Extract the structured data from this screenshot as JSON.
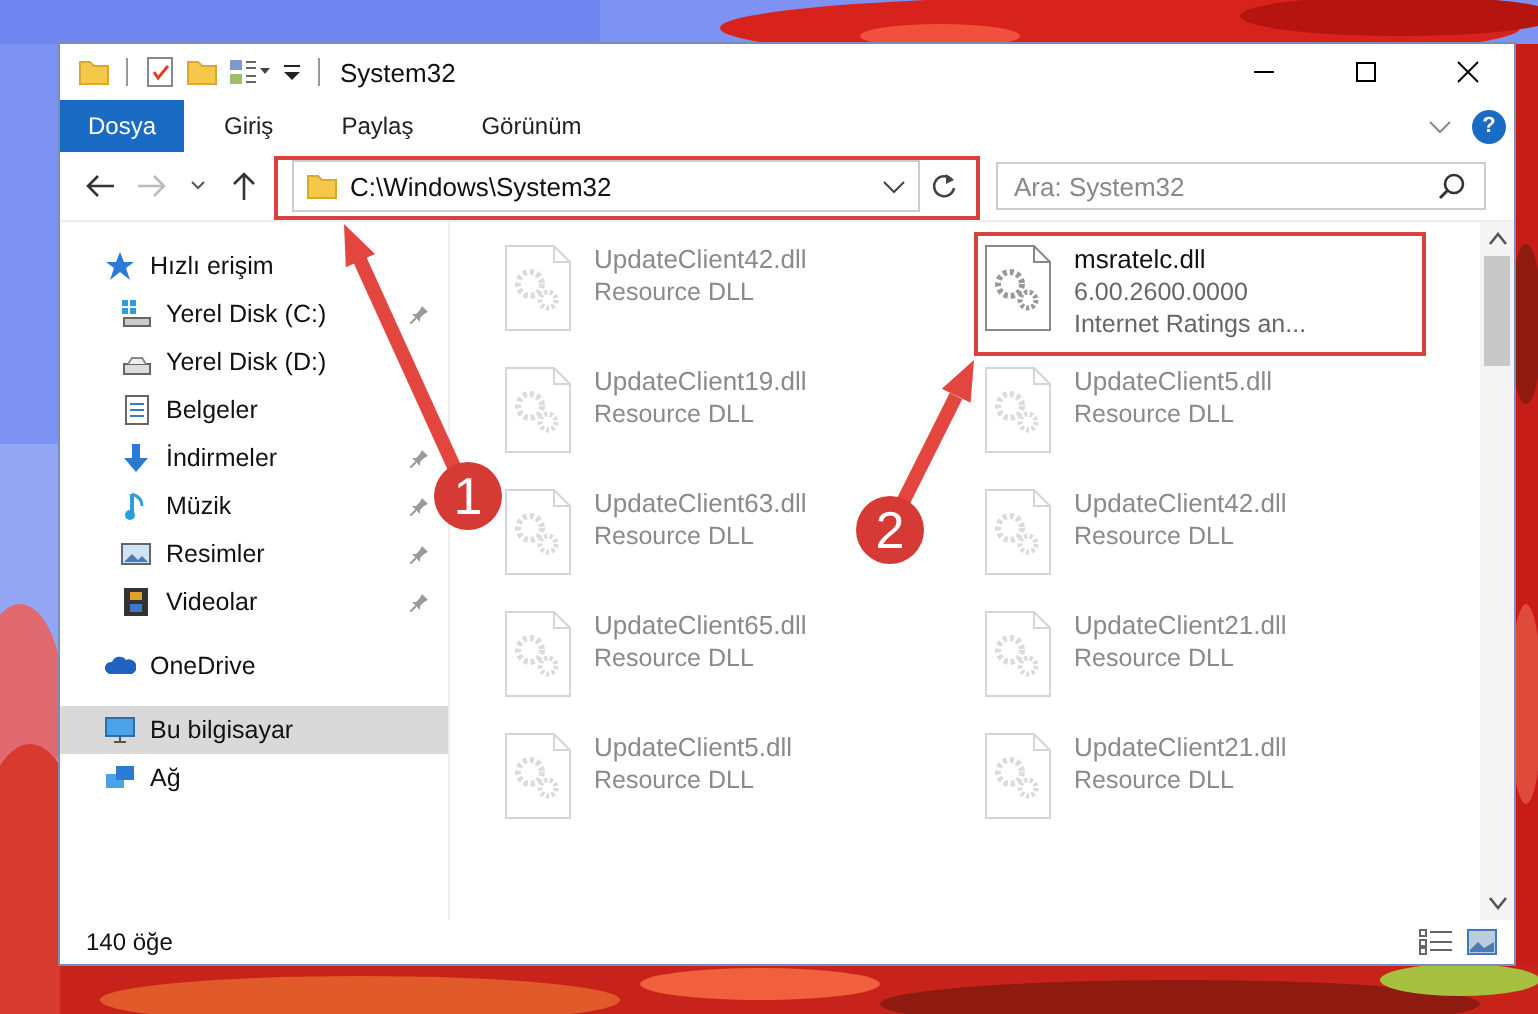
{
  "window": {
    "title": "System32"
  },
  "ribbon_tabs": [
    {
      "label": "Dosya",
      "selected": true
    },
    {
      "label": "Giriş",
      "selected": false
    },
    {
      "label": "Paylaş",
      "selected": false
    },
    {
      "label": "Görünüm",
      "selected": false
    }
  ],
  "help_label": "?",
  "address": {
    "value": "C:\\Windows\\System32"
  },
  "search": {
    "placeholder": "Ara: System32"
  },
  "sidebar": {
    "items": [
      {
        "label": "Hızlı erişim",
        "selected": false,
        "children": [
          {
            "label": "Yerel Disk (C:)",
            "pinned": true
          },
          {
            "label": "Yerel Disk (D:)",
            "pinned": false
          },
          {
            "label": "Belgeler",
            "pinned": false
          },
          {
            "label": "İndirmeler",
            "pinned": true
          },
          {
            "label": "Müzik",
            "pinned": true
          },
          {
            "label": "Resimler",
            "pinned": true
          },
          {
            "label": "Videolar",
            "pinned": true
          }
        ]
      },
      {
        "label": "OneDrive",
        "selected": false
      },
      {
        "label": "Bu bilgisayar",
        "selected": true
      },
      {
        "label": "Ağ",
        "selected": false
      }
    ]
  },
  "files": [
    {
      "name": "UpdateClient42.dll",
      "lines": [
        "Resource DLL"
      ],
      "faded": true
    },
    {
      "name": "msratelc.dll",
      "lines": [
        "6.00.2600.0000",
        "Internet Ratings an..."
      ],
      "faded": false
    },
    {
      "name": "UpdateClient19.dll",
      "lines": [
        "Resource DLL"
      ],
      "faded": true
    },
    {
      "name": "UpdateClient5.dll",
      "lines": [
        "Resource DLL"
      ],
      "faded": true
    },
    {
      "name": "UpdateClient63.dll",
      "lines": [
        "Resource DLL"
      ],
      "faded": true
    },
    {
      "name": "UpdateClient42.dll",
      "lines": [
        "Resource DLL"
      ],
      "faded": true
    },
    {
      "name": "UpdateClient65.dll",
      "lines": [
        "Resource DLL"
      ],
      "faded": true
    },
    {
      "name": "UpdateClient21.dll",
      "lines": [
        "Resource DLL"
      ],
      "faded": true
    },
    {
      "name": "UpdateClient5.dll",
      "lines": [
        "Resource DLL"
      ],
      "faded": true
    },
    {
      "name": "UpdateClient21.dll",
      "lines": [
        "Resource DLL"
      ],
      "faded": true
    }
  ],
  "status_bar": {
    "item_count": "140 öğe"
  },
  "annotations": [
    {
      "number": "1"
    },
    {
      "number": "2"
    }
  ]
}
